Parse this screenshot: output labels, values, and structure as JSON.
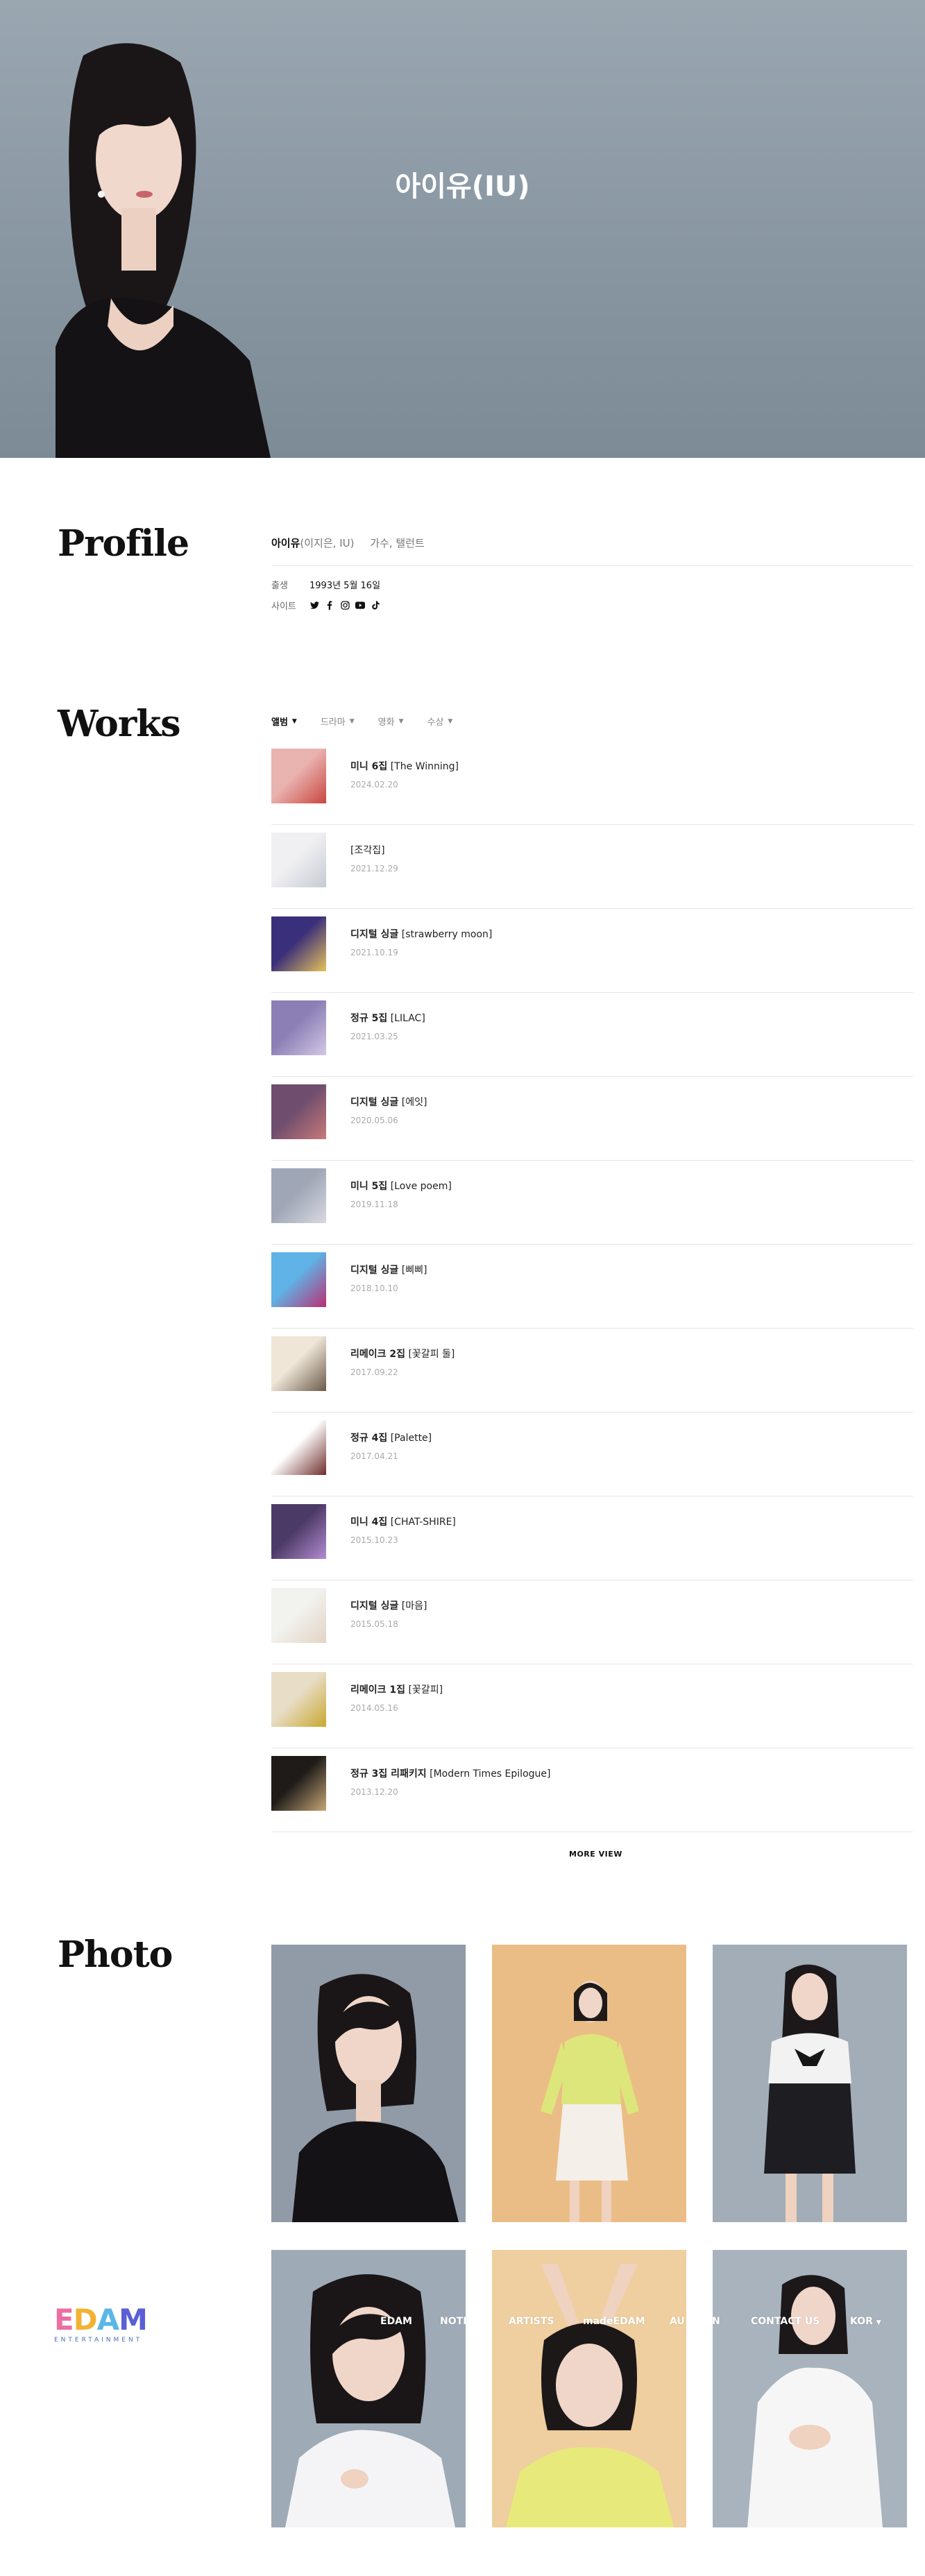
{
  "hero": {
    "title": "아이유(IU)"
  },
  "profile": {
    "heading": "Profile",
    "name": "아이유",
    "alias": "(이지은, IU)",
    "roles": "가수, 탤런트",
    "birth_label": "출생",
    "birth_value": "1993년 5월 16일",
    "site_label": "사이트",
    "social_icons": [
      "twitter-icon",
      "facebook-icon",
      "instagram-icon",
      "youtube-icon",
      "tiktok-icon"
    ]
  },
  "works": {
    "heading": "Works",
    "tabs": [
      "앨범",
      "드라마",
      "영화",
      "수상"
    ],
    "items": [
      {
        "type": "미니 6집",
        "title": "[The Winning]",
        "date": "2024.02.20",
        "colors": [
          "#e9b3b0",
          "#c9463f"
        ]
      },
      {
        "type": "",
        "title": "[조각집]",
        "date": "2021.12.29",
        "colors": [
          "#f0f0f2",
          "#c7cad3"
        ]
      },
      {
        "type": "디지털 싱글",
        "title": "[strawberry moon]",
        "date": "2021.10.19",
        "colors": [
          "#3a2f7a",
          "#e7c25a"
        ]
      },
      {
        "type": "정규 5집",
        "title": "[LILAC]",
        "date": "2021.03.25",
        "colors": [
          "#8c7fb6",
          "#d3c8e6"
        ]
      },
      {
        "type": "디지털 싱글",
        "title": "[에잇]",
        "date": "2020.05.06",
        "colors": [
          "#6e4d6e",
          "#c77a7a"
        ]
      },
      {
        "type": "미니 5집",
        "title": "[Love poem]",
        "date": "2019.11.18",
        "colors": [
          "#9fa6b5",
          "#d9dae2"
        ]
      },
      {
        "type": "디지털 싱글",
        "title": "[삐삐]",
        "date": "2018.10.10",
        "colors": [
          "#5fb3e6",
          "#ba2f73"
        ]
      },
      {
        "type": "리메이크 2집",
        "title": "[꽃갈피 둘]",
        "date": "2017.09.22",
        "colors": [
          "#efe6d8",
          "#6b5a4a"
        ]
      },
      {
        "type": "정규 4집",
        "title": "[Palette]",
        "date": "2017.04.21",
        "colors": [
          "#ffffff",
          "#6e2e2b"
        ]
      },
      {
        "type": "미니 4집",
        "title": "[CHAT-SHIRE]",
        "date": "2015.10.23",
        "colors": [
          "#4c3a66",
          "#b38bd1"
        ]
      },
      {
        "type": "디지털 싱글",
        "title": "[마음]",
        "date": "2015.05.18",
        "colors": [
          "#f2f2ef",
          "#e2d4c4"
        ]
      },
      {
        "type": "리메이크 1집",
        "title": "[꽃갈피]",
        "date": "2014.05.16",
        "colors": [
          "#e8ddc6",
          "#c9a830"
        ]
      },
      {
        "type": "정규 3집 리패키지",
        "title": "[Modern Times Epilogue]",
        "date": "2013.12.20",
        "colors": [
          "#1e1b18",
          "#c8a678"
        ]
      }
    ],
    "more_label": "MORE VIEW"
  },
  "photo": {
    "heading": "Photo"
  },
  "footer": {
    "logo_text": "EDAM",
    "logo_sub": "ENTERTAINMENT",
    "nav": [
      "EDAM",
      "NOTI",
      "ARTISTS",
      "madeEDAM",
      "AU",
      "N",
      "CONTACT US",
      "KOR"
    ]
  },
  "colors": {
    "accent_hero": "#8795a1",
    "logo_e": "#ec6fa2",
    "logo_d": "#f3b233",
    "logo_a": "#5ab7e7",
    "logo_m": "#5a5fd6"
  }
}
